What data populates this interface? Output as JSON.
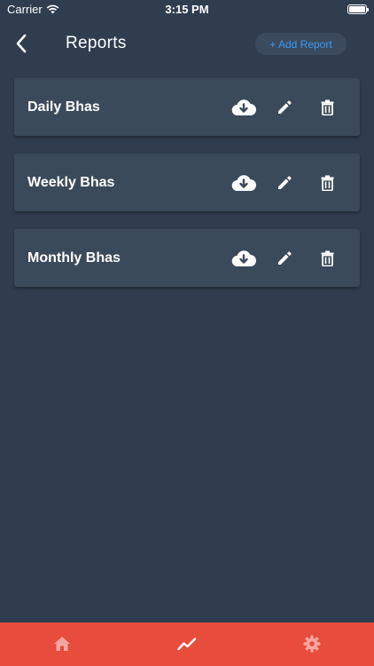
{
  "status_bar": {
    "carrier": "Carrier",
    "time": "3:15 PM"
  },
  "nav": {
    "title": "Reports",
    "add_report_label": "+ Add Report",
    "back_icon": "chevron-left-icon"
  },
  "reports": [
    {
      "name": "Daily Bhas"
    },
    {
      "name": "Weekly Bhas"
    },
    {
      "name": "Monthly Bhas"
    }
  ],
  "report_actions": [
    "cloud-download-icon",
    "pencil-icon",
    "trash-icon"
  ],
  "tab_bar": {
    "tabs": [
      "home-icon",
      "trend-chart-icon",
      "gear-icon"
    ],
    "active_tab": "trend-chart-icon"
  },
  "colors": {
    "background": "#2f3d4f",
    "card": "#3b4a5b",
    "accent": "#3a9bf5",
    "tab_bar": "#e74c3c",
    "tab_icon": "#f5a6a0"
  }
}
